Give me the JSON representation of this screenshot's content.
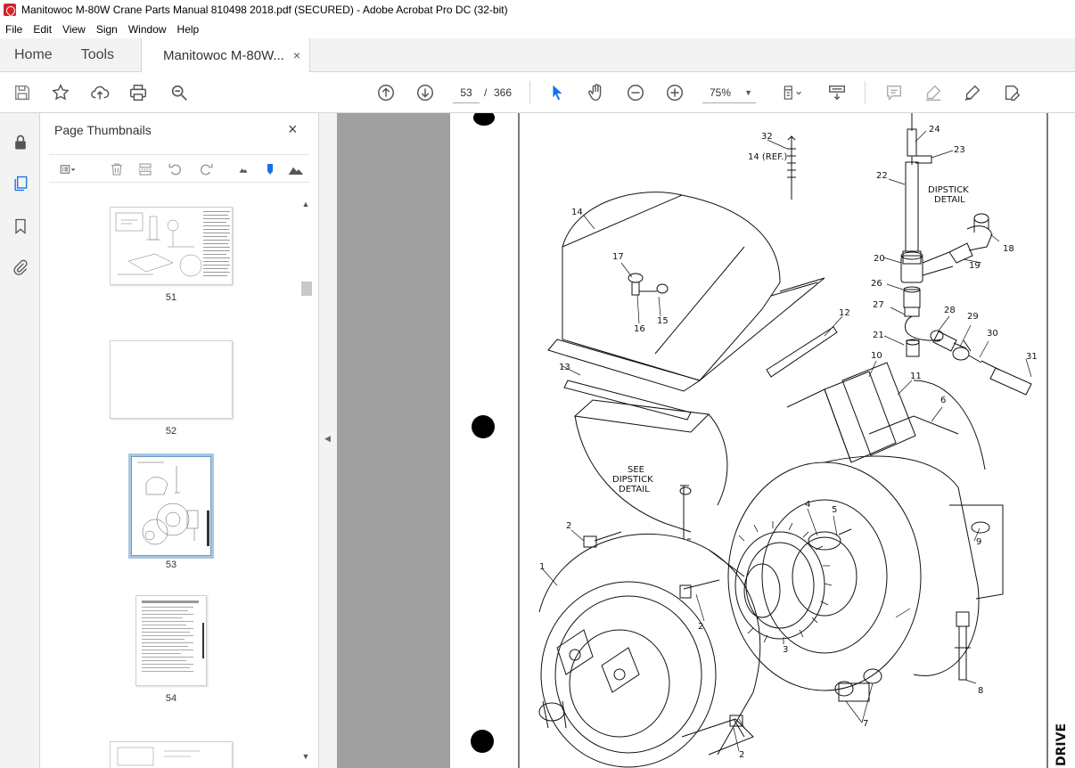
{
  "window": {
    "title": "Manitowoc M-80W Crane Parts Manual 810498 2018.pdf (SECURED) - Adobe Acrobat Pro DC (32-bit)"
  },
  "menu": [
    "File",
    "Edit",
    "View",
    "Sign",
    "Window",
    "Help"
  ],
  "tabs": {
    "home": "Home",
    "tools": "Tools",
    "document": "Manitowoc M-80W...",
    "close": "×"
  },
  "toolbar": {
    "current_page": "53",
    "page_separator": "/",
    "total_pages": "366",
    "zoom": "75%",
    "icons": [
      "save-icon",
      "star-icon",
      "upload-icon",
      "print-icon",
      "find-icon",
      "page-up-icon",
      "page-down-icon",
      "select-cursor-icon",
      "hand-icon",
      "zoom-out-icon",
      "zoom-in-icon",
      "fit-page-icon",
      "scroll-mode-icon",
      "comment-icon",
      "highlight-icon",
      "sign-icon",
      "fill-sign-icon"
    ]
  },
  "thumbnails_pane": {
    "title": "Page Thumbnails",
    "close": "×",
    "pages": [
      {
        "label": "51"
      },
      {
        "label": "52"
      },
      {
        "label": "53",
        "selected": true
      },
      {
        "label": "54"
      }
    ]
  },
  "drawing": {
    "labels": [
      "32",
      "14 (REF.)",
      "24",
      "23",
      "22",
      "DIPSTICK",
      "DETAIL",
      "18",
      "19",
      "20",
      "26",
      "27",
      "28",
      "29",
      "21",
      "30",
      "31",
      "14",
      "17",
      "15",
      "16",
      "12",
      "13",
      "10",
      "11",
      "6",
      "SEE",
      "DIPSTICK",
      "DETAIL",
      "2",
      "1",
      "4",
      "5",
      "9",
      "3",
      "2",
      "8",
      "7",
      "2"
    ],
    "side_text": "DRIVE"
  },
  "colors": {
    "accent": "#1473e6",
    "app_red": "#d6232b",
    "doc_bg": "#a0a0a0"
  }
}
